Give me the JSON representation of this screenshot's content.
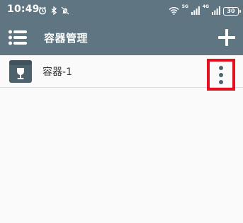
{
  "status_bar": {
    "time": "10:49",
    "left_icons": [
      "alarm-icon",
      "bluetooth-icon",
      "mute-icon"
    ],
    "right_icons": [
      "wifi-icon",
      "signal-icon",
      "signal-icon"
    ],
    "sim1_label": "5G",
    "sim2_label": "4G",
    "battery": "30"
  },
  "app_bar": {
    "menu_icon": "menu-icon",
    "title": "容器管理",
    "add_icon": "plus-icon"
  },
  "containers": [
    {
      "name": "容器-1",
      "icon": "container-box-icon",
      "action_icon": "more-vertical-icon"
    }
  ],
  "colors": {
    "app_bar": "#5f7682",
    "highlight": "#e3101f",
    "icon_dark": "#4e626e"
  }
}
